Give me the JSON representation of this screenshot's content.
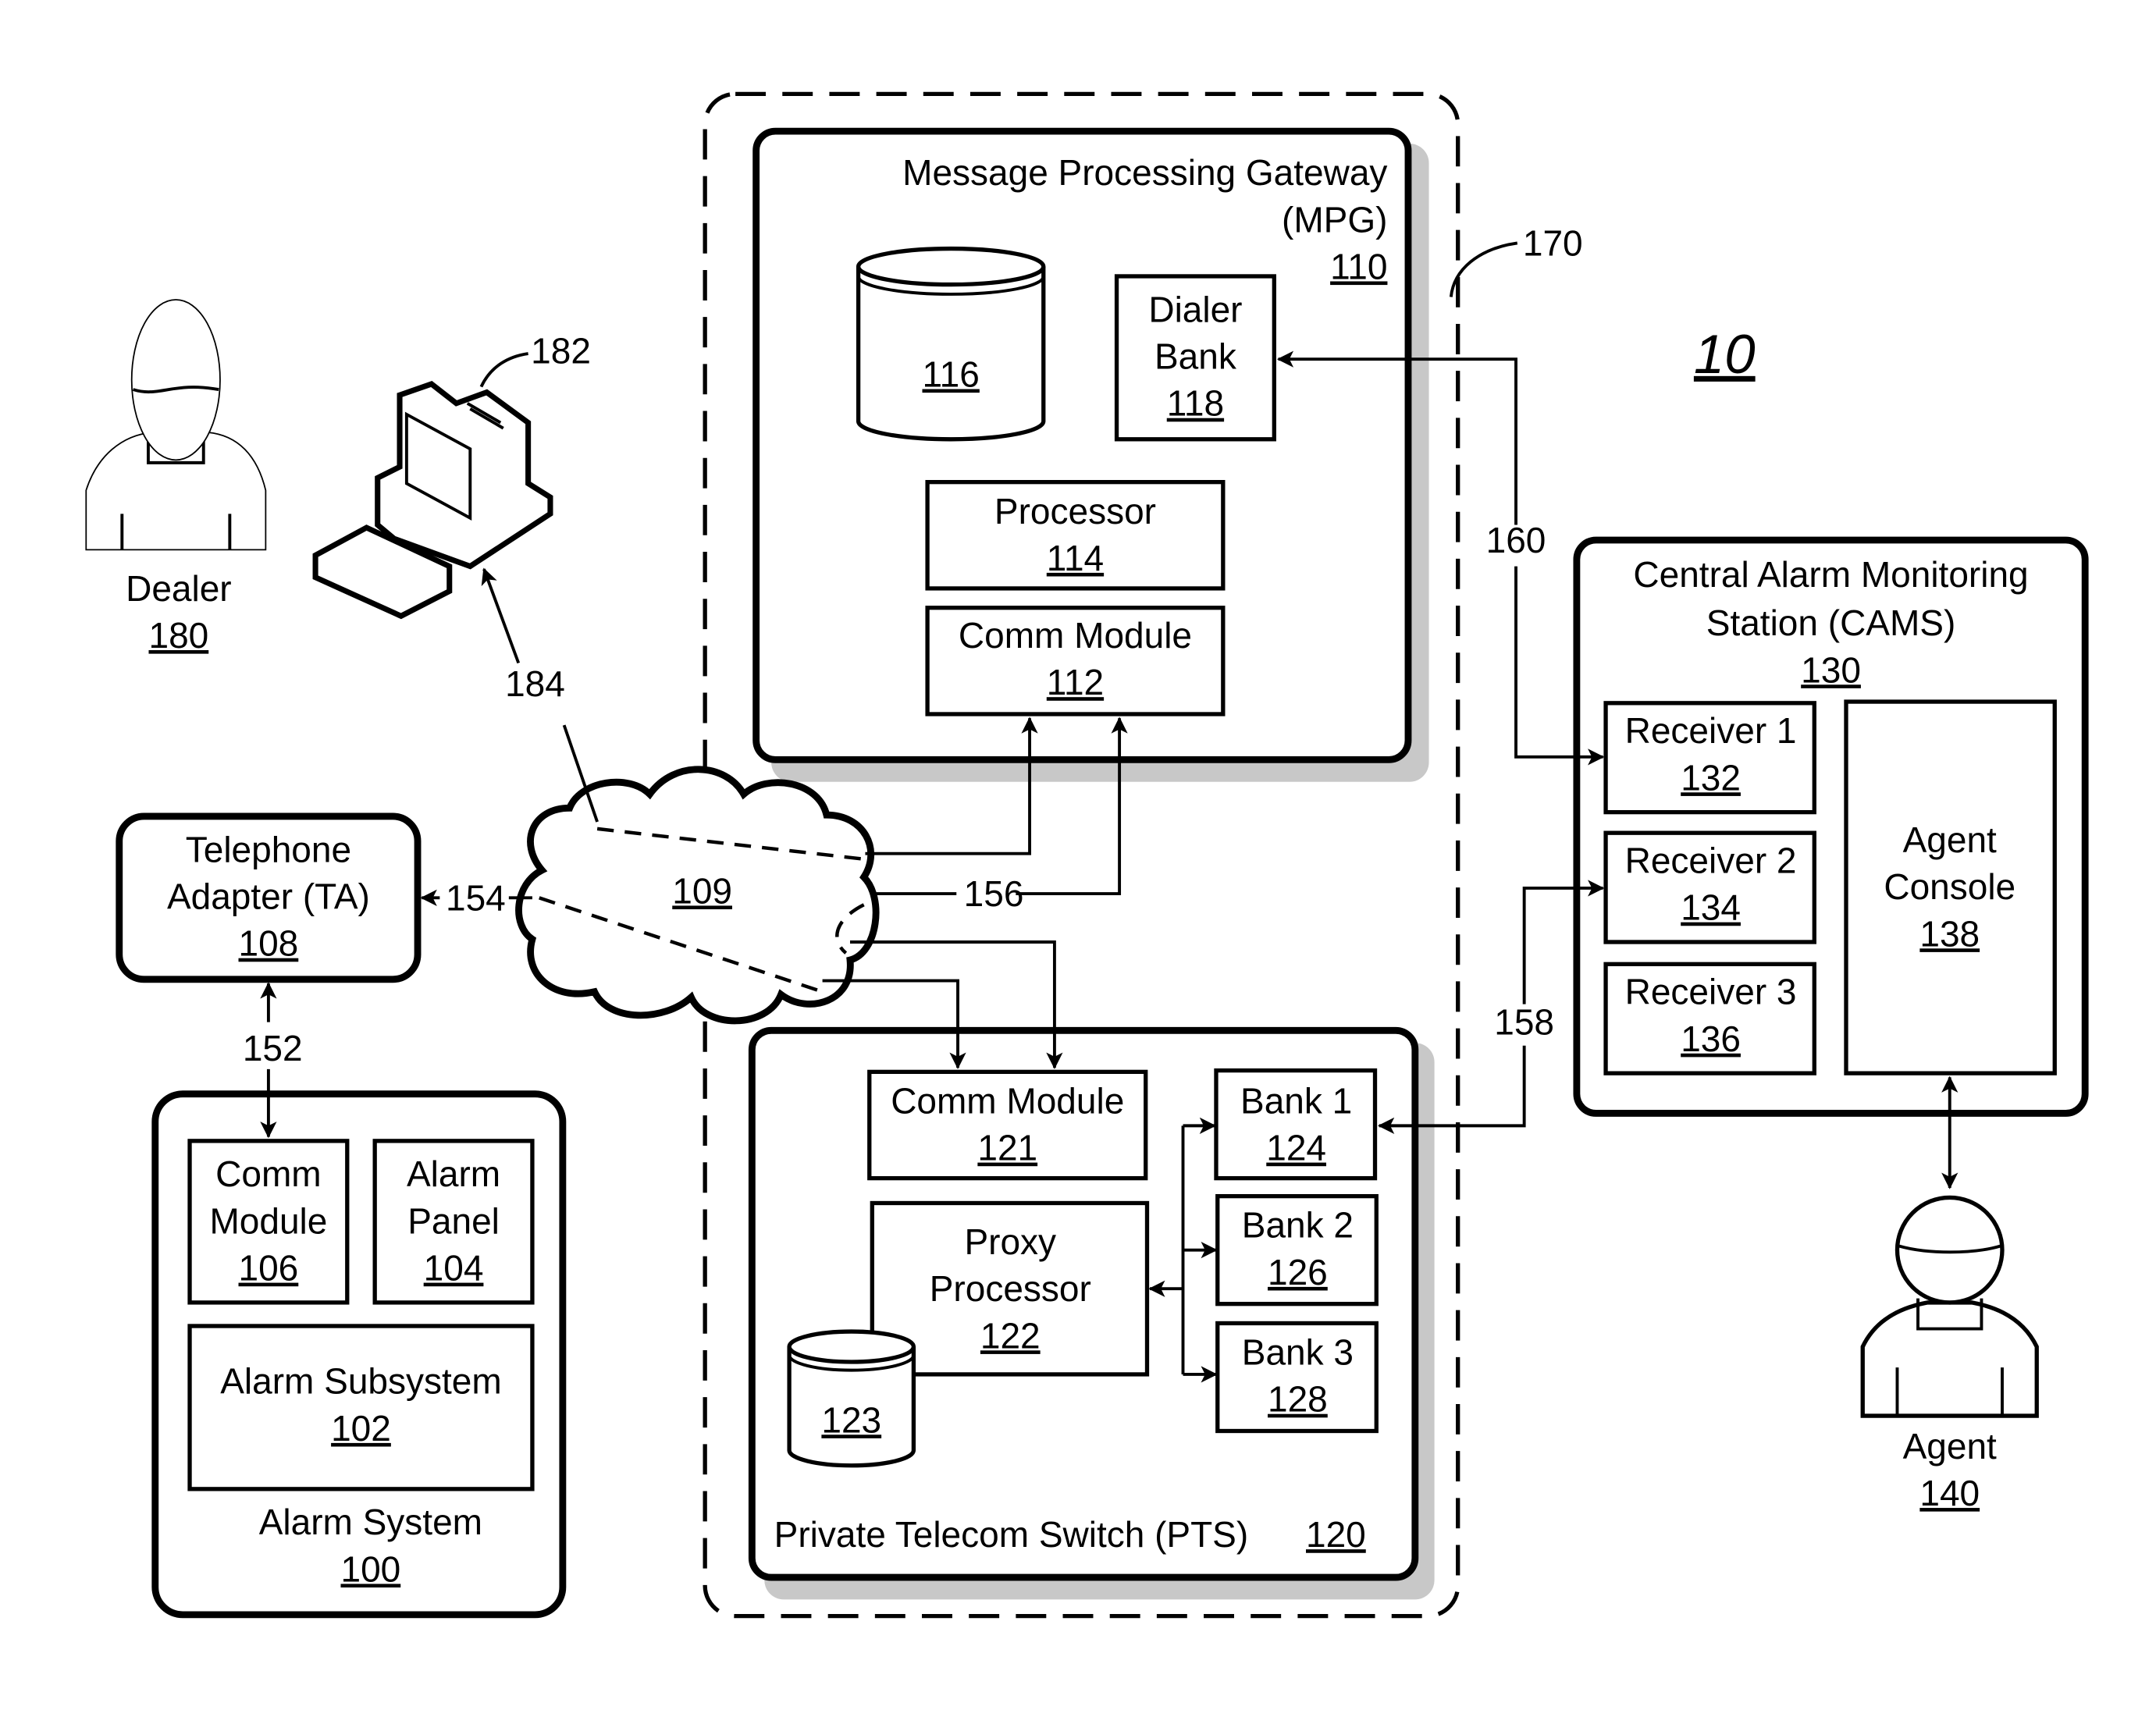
{
  "figure": {
    "number": "10"
  },
  "boundary": {
    "ref": "170"
  },
  "mpg": {
    "title_line1": "Message Processing Gateway",
    "title_line2": "(MPG)",
    "ref": "110",
    "database_ref": "116",
    "dialer_bank": {
      "line1": "Dialer",
      "line2": "Bank",
      "ref": "118"
    },
    "processor": {
      "label": "Processor",
      "ref": "114"
    },
    "comm_module": {
      "label": "Comm Module",
      "ref": "112"
    }
  },
  "pts": {
    "title": "Private Telecom Switch (PTS)",
    "ref": "120",
    "comm_module": {
      "label": "Comm Module",
      "ref": "121"
    },
    "proxy_processor": {
      "line1": "Proxy",
      "line2": "Processor",
      "ref": "122"
    },
    "database_ref": "123",
    "banks": [
      {
        "label": "Bank 1",
        "ref": "124"
      },
      {
        "label": "Bank 2",
        "ref": "126"
      },
      {
        "label": "Bank 3",
        "ref": "128"
      }
    ]
  },
  "cams": {
    "title_line1": "Central Alarm Monitoring",
    "title_line2": "Station (CAMS)",
    "ref": "130",
    "receivers": [
      {
        "label": "Receiver 1",
        "ref": "132"
      },
      {
        "label": "Receiver 2",
        "ref": "134"
      },
      {
        "label": "Receiver 3",
        "ref": "136"
      }
    ],
    "agent_console": {
      "line1": "Agent",
      "line2": "Console",
      "ref": "138"
    }
  },
  "agent": {
    "label": "Agent",
    "ref": "140"
  },
  "dealer": {
    "label": "Dealer",
    "ref": "180",
    "computer_ref": "182"
  },
  "network": {
    "ref": "109"
  },
  "telephone_adapter": {
    "line1": "Telephone",
    "line2": "Adapter (TA)",
    "ref": "108"
  },
  "alarm_system": {
    "title": "Alarm System",
    "ref": "100",
    "comm_module": {
      "line1": "Comm",
      "line2": "Module",
      "ref": "106"
    },
    "alarm_panel": {
      "line1": "Alarm",
      "line2": "Panel",
      "ref": "104"
    },
    "alarm_subsystem": {
      "label": "Alarm Subsystem",
      "ref": "102"
    }
  },
  "connections": {
    "ta_alarm": "152",
    "cloud_ta": "154",
    "cloud_mpg_pts": "156",
    "pts_cams": "158",
    "mpg_cams": "160",
    "cloud_computer": "184"
  }
}
